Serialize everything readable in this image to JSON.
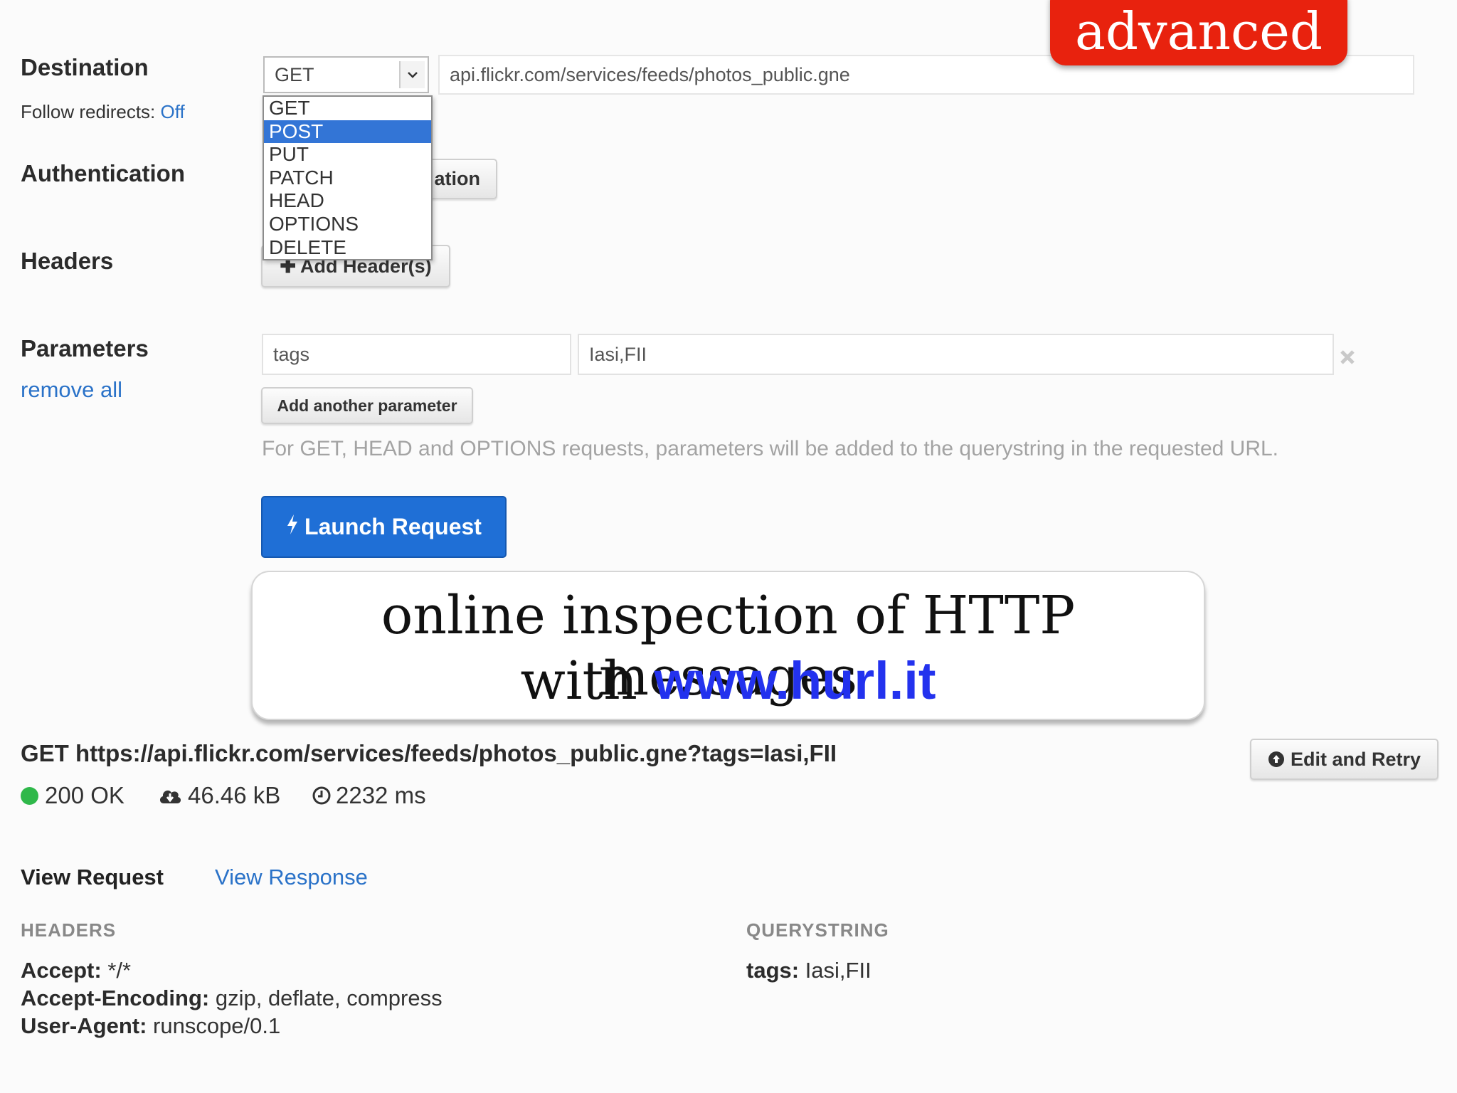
{
  "badge": "advanced",
  "destination": {
    "label": "Destination",
    "follow_label": "Follow redirects:",
    "follow_value": "Off",
    "method": "GET",
    "url": "api.flickr.com/services/feeds/photos_public.gne",
    "methods": [
      "GET",
      "POST",
      "PUT",
      "PATCH",
      "HEAD",
      "OPTIONS",
      "DELETE"
    ],
    "highlighted": "POST"
  },
  "authentication": {
    "label": "Authentication",
    "button_partial": "ation"
  },
  "headers": {
    "label": "Headers",
    "add_button": "Add Header(s)"
  },
  "parameters": {
    "label": "Parameters",
    "remove_all": "remove all",
    "name": "tags",
    "value": "Iasi,FII",
    "add_button": "Add another parameter",
    "hint": "For GET, HEAD and OPTIONS requests, parameters will be added to the querystring in the requested URL."
  },
  "launch_button": "Launch Request",
  "overlay": {
    "line1": "online inspection of HTTP messages",
    "line2_prefix": "with",
    "line2_url": "www.hurl.it"
  },
  "response": {
    "request_line": "GET https://api.flickr.com/services/feeds/photos_public.gne?tags=Iasi,FII",
    "status": "200 OK",
    "size": "46.46 kB",
    "time": "2232 ms",
    "edit_button": "Edit and Retry",
    "tab_request": "View Request",
    "tab_response": "View Response",
    "headers_title": "HEADERS",
    "querystring_title": "QUERYSTRING",
    "headers": [
      {
        "k": "Accept:",
        "v": " */*"
      },
      {
        "k": "Accept-Encoding:",
        "v": " gzip, deflate, compress"
      },
      {
        "k": "User-Agent:",
        "v": " runscope/0.1"
      }
    ],
    "query": [
      {
        "k": "tags:",
        "v": " Iasi,FII"
      }
    ]
  },
  "colors": {
    "accent": "#1f6fd6",
    "badge": "#e8220e",
    "status_ok": "#2fb84a",
    "link": "#2a72c8"
  }
}
